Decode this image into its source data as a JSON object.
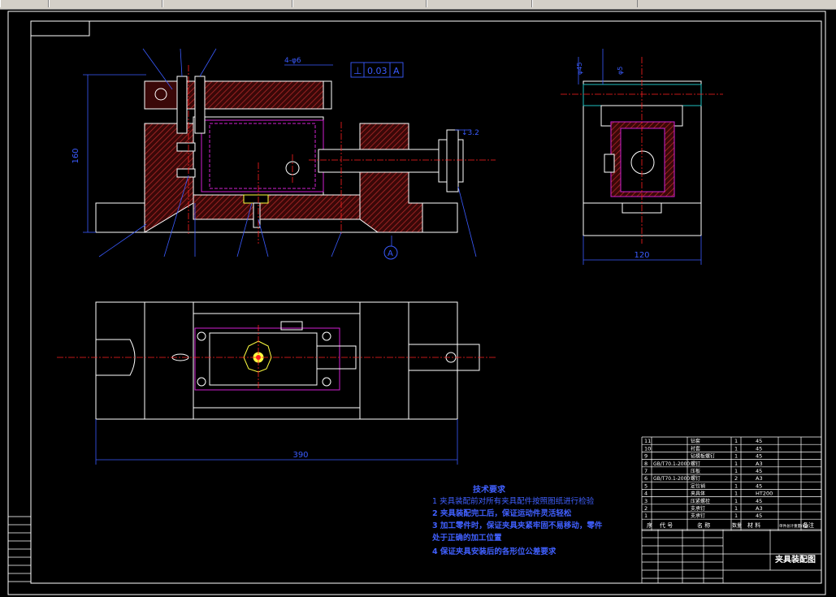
{
  "toolbar": {
    "cells": [
      "",
      "",
      "",
      "",
      "",
      ""
    ]
  },
  "drawing": {
    "dim_height": "160",
    "dim_width_side": "120",
    "dim_width_plan": "390",
    "dim_hole": "4-φ6",
    "tolerance_symbol": "⊥",
    "tolerance_value": "0.03",
    "datum_ref": "A",
    "datum_marker": "A",
    "side_dim_1": "φ45",
    "side_dim_2": "φ5",
    "callout_roughness": "↓3.2"
  },
  "tech_requirements": {
    "title": "技术要求",
    "items": [
      "1  夹具装配前对所有夹具配件按照图纸进行检验",
      "2  夹具装配完工后，保证运动件灵活轻松",
      "3  加工零件时，保证夹具夹紧牢固不易移动，零件",
      "    处于正确的加工位置",
      "4  保证夹具安装后的各形位公差要求"
    ]
  },
  "bom": {
    "rows": [
      {
        "no": "11",
        "code": "",
        "name": "钻套",
        "qty": "1",
        "material": "45"
      },
      {
        "no": "10",
        "code": "",
        "name": "衬套",
        "qty": "1",
        "material": "45"
      },
      {
        "no": "9",
        "code": "",
        "name": "钻模板螺钉",
        "qty": "1",
        "material": "45"
      },
      {
        "no": "8",
        "code": "GB/T70.1-2000",
        "name": "螺钉",
        "qty": "1",
        "material": "A3"
      },
      {
        "no": "7",
        "code": "",
        "name": "压板",
        "qty": "1",
        "material": "45"
      },
      {
        "no": "6",
        "code": "GB/T70.1-2000",
        "name": "螺钉",
        "qty": "2",
        "material": "A3"
      },
      {
        "no": "5",
        "code": "",
        "name": "定位销",
        "qty": "1",
        "material": "45"
      },
      {
        "no": "4",
        "code": "",
        "name": "夹具体",
        "qty": "1",
        "material": "HT200"
      },
      {
        "no": "3",
        "code": "",
        "name": "压紧螺栓",
        "qty": "1",
        "material": "45"
      },
      {
        "no": "2",
        "code": "",
        "name": "支承钉",
        "qty": "1",
        "material": "A3"
      },
      {
        "no": "1",
        "code": "",
        "name": "支承钉",
        "qty": "1",
        "material": "45"
      }
    ],
    "header": {
      "no": "序",
      "code": "代 号",
      "name": "名 称",
      "qty": "数量",
      "material": "材 料",
      "weight": "单件总计重量(kg)",
      "remark": "备注"
    }
  },
  "title_block": {
    "drawing_name": "夹具装配图"
  },
  "colors": {
    "background": "#000000",
    "outline": "#ffffff",
    "dimension": "#3a5bff",
    "centerline": "#ff2020",
    "hatch": "#a02020",
    "part": "#d020d0",
    "highlight": "#ffff40",
    "text_blue": "#4060ff",
    "cyan": "#20c0c0"
  }
}
